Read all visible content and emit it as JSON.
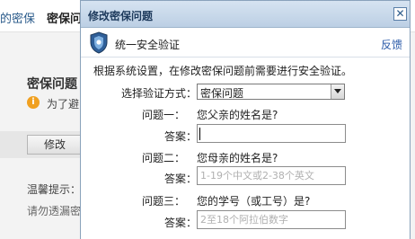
{
  "background": {
    "nav": [
      "的密保",
      "密保问"
    ],
    "section_title": "密保问题",
    "warn_icon": "i",
    "warn_text": "为了避",
    "modify_button": "修改",
    "tip_title": "温馨提示：",
    "tip_text": "请勿透漏密"
  },
  "dialog": {
    "title": "修改密保问题",
    "close_label": "✕",
    "header": {
      "title": "统一安全验证",
      "feedback": "反馈",
      "icon": "shield-icon"
    },
    "intro": "根据系统设置，在修改密保问题前需要进行安全验证。",
    "verify": {
      "label": "选择验证方式：",
      "selected": "密保问题"
    },
    "questions": [
      {
        "label": "问题一：",
        "question": "您父亲的姓名是?",
        "answer_label": "答案：",
        "answer_value": "",
        "placeholder": ""
      },
      {
        "label": "问题二：",
        "question": "您母亲的姓名是?",
        "answer_label": "答案：",
        "answer_value": "",
        "placeholder": "1-19个中文或2-38个英文"
      },
      {
        "label": "问题三：",
        "question": "您的学号（或工号）是?",
        "answer_label": "答案：",
        "answer_value": "",
        "placeholder": "2至18个阿拉伯数字"
      }
    ]
  }
}
